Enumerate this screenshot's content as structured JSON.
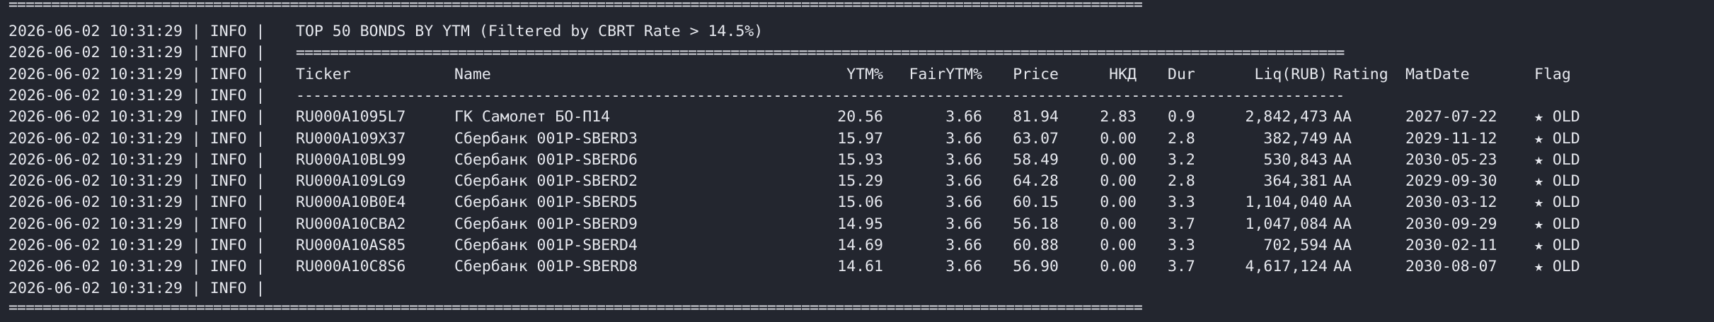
{
  "log": {
    "top_rule": "=====================================================================================================================================",
    "bottom_rule": "=====================================================================================================================================",
    "header_rule": "===========================================================================================================================",
    "sub_rule": "---------------------------------------------------------------------------------------------------------------------------",
    "lines": [
      {
        "ts": "2026-06-02 10:31:29",
        "level": "INFO",
        "msg": "TOP 50 BONDS BY YTM (Filtered by CBRT Rate > 14.5%)"
      },
      {
        "ts": "2026-06-02 10:31:29",
        "level": "INFO"
      },
      {
        "ts": "2026-06-02 10:31:29",
        "level": "INFO"
      },
      {
        "ts": "2026-06-02 10:31:29",
        "level": "INFO"
      },
      {
        "ts": "2026-06-02 10:31:29",
        "level": "INFO"
      },
      {
        "ts": "2026-06-02 10:31:29",
        "level": "INFO"
      },
      {
        "ts": "2026-06-02 10:31:29",
        "level": "INFO"
      },
      {
        "ts": "2026-06-02 10:31:29",
        "level": "INFO"
      },
      {
        "ts": "2026-06-02 10:31:29",
        "level": "INFO"
      },
      {
        "ts": "2026-06-02 10:31:29",
        "level": "INFO"
      },
      {
        "ts": "2026-06-02 10:31:29",
        "level": "INFO"
      },
      {
        "ts": "2026-06-02 10:31:29",
        "level": "INFO"
      },
      {
        "ts": "2026-06-02 10:31:29",
        "level": "INFO"
      }
    ]
  },
  "table": {
    "headers": {
      "ticker": "Ticker",
      "name": "Name",
      "ytm": "YTM%",
      "fair": "FairYTM%",
      "price": "Price",
      "nkd": "НКД",
      "dur": "Dur",
      "liq": "Liq(RUB)",
      "rating": "Rating",
      "matdate": "MatDate",
      "flag": "Flag"
    },
    "rows": [
      {
        "ticker": "RU000A1095L7",
        "name": "ГК Самолет БО-П14",
        "ytm": "20.56",
        "fair": "3.66",
        "price": "81.94",
        "nkd": "2.83",
        "dur": "0.9",
        "liq": "2,842,473",
        "rating": "AA",
        "matdate": "2027-07-22",
        "flag": "★ OLD"
      },
      {
        "ticker": "RU000A109X37",
        "name": "Сбербанк 001P-SBERD3",
        "ytm": "15.97",
        "fair": "3.66",
        "price": "63.07",
        "nkd": "0.00",
        "dur": "2.8",
        "liq": "382,749",
        "rating": "AA",
        "matdate": "2029-11-12",
        "flag": "★ OLD"
      },
      {
        "ticker": "RU000A10BL99",
        "name": "Сбербанк 001P-SBERD6",
        "ytm": "15.93",
        "fair": "3.66",
        "price": "58.49",
        "nkd": "0.00",
        "dur": "3.2",
        "liq": "530,843",
        "rating": "AA",
        "matdate": "2030-05-23",
        "flag": "★ OLD"
      },
      {
        "ticker": "RU000A109LG9",
        "name": "Сбербанк 001P-SBERD2",
        "ytm": "15.29",
        "fair": "3.66",
        "price": "64.28",
        "nkd": "0.00",
        "dur": "2.8",
        "liq": "364,381",
        "rating": "AA",
        "matdate": "2029-09-30",
        "flag": "★ OLD"
      },
      {
        "ticker": "RU000A10B0E4",
        "name": "Сбербанк 001P-SBERD5",
        "ytm": "15.06",
        "fair": "3.66",
        "price": "60.15",
        "nkd": "0.00",
        "dur": "3.3",
        "liq": "1,104,040",
        "rating": "AA",
        "matdate": "2030-03-12",
        "flag": "★ OLD"
      },
      {
        "ticker": "RU000A10CBA2",
        "name": "Сбербанк 001P-SBERD9",
        "ytm": "14.95",
        "fair": "3.66",
        "price": "56.18",
        "nkd": "0.00",
        "dur": "3.7",
        "liq": "1,047,084",
        "rating": "AA",
        "matdate": "2030-09-29",
        "flag": "★ OLD"
      },
      {
        "ticker": "RU000A10AS85",
        "name": "Сбербанк 001P-SBERD4",
        "ytm": "14.69",
        "fair": "3.66",
        "price": "60.88",
        "nkd": "0.00",
        "dur": "3.3",
        "liq": "702,594",
        "rating": "AA",
        "matdate": "2030-02-11",
        "flag": "★ OLD"
      },
      {
        "ticker": "RU000A10C8S6",
        "name": "Сбербанк 001P-SBERD8",
        "ytm": "14.61",
        "fair": "3.66",
        "price": "56.90",
        "nkd": "0.00",
        "dur": "3.7",
        "liq": "4,617,124",
        "rating": "AA",
        "matdate": "2030-08-07",
        "flag": "★ OLD"
      }
    ]
  },
  "colors": {
    "background": "#23262f",
    "text": "#e6e8ee"
  }
}
